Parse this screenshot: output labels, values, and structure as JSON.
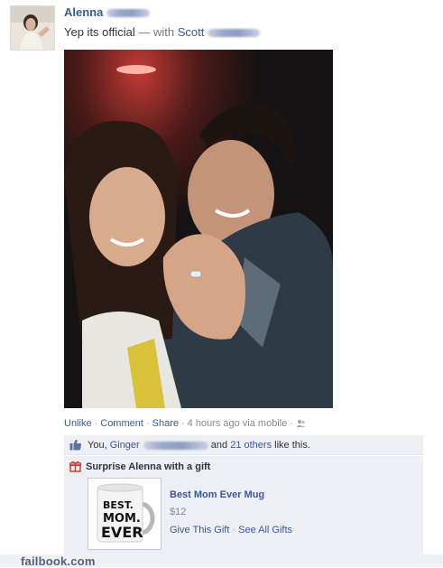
{
  "post": {
    "author": "Alenna",
    "status_text": "Yep its official",
    "with_text": "— with",
    "tagged_name": "Scott"
  },
  "actions": {
    "unlike": "Unlike",
    "comment": "Comment",
    "share": "Share",
    "time": "4 hours ago via mobile",
    "separator": "·",
    "audience_icon": "friends-icon"
  },
  "likes": {
    "prefix": "You,",
    "name": "Ginger",
    "middle": "and",
    "others_link": "21 others",
    "suffix": "like this."
  },
  "gift": {
    "title": "Surprise Alenna with a gift",
    "name": "Best Mom Ever Mug",
    "price": "$12",
    "give_link": "Give This Gift",
    "see_all_link": "See All Gifts",
    "mug_text_1": "BEST.",
    "mug_text_2": "MOM.",
    "mug_text_3": "EVER"
  },
  "watermark": "failbook.com",
  "colors": {
    "link": "#3b5998",
    "panel": "#edeff4"
  }
}
